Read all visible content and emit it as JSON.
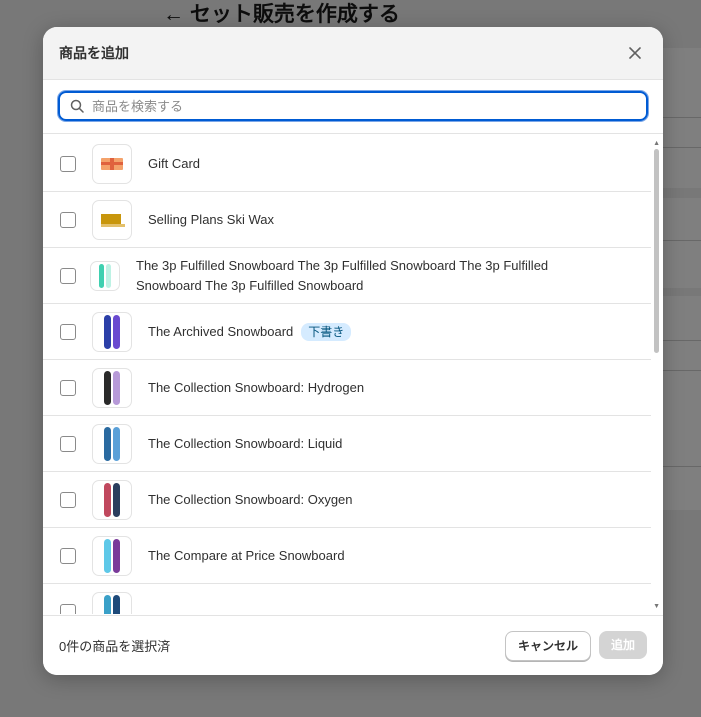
{
  "background": {
    "page_title": "← セット販売を作成する"
  },
  "modal": {
    "title": "商品を追加",
    "close_icon": "close-icon",
    "search": {
      "placeholder": "商品を検索する",
      "value": ""
    },
    "products": [
      {
        "name": "Gift Card",
        "thumb": "gift-card",
        "badge": ""
      },
      {
        "name": "Selling Plans Ski Wax",
        "thumb": "ski-wax",
        "badge": ""
      },
      {
        "name": "The 3p Fulfilled Snowboard The 3p Fulfilled Snowboard The 3p Fulfilled Snowboard The 3p Fulfilled Snowboard",
        "thumb": "snowboard-teal",
        "badge": ""
      },
      {
        "name": "The Archived Snowboard",
        "thumb": "snowboard-purple",
        "badge": "下書き"
      },
      {
        "name": "The Collection Snowboard: Hydrogen",
        "thumb": "snowboard-dark",
        "badge": ""
      },
      {
        "name": "The Collection Snowboard: Liquid",
        "thumb": "snowboard-blue",
        "badge": ""
      },
      {
        "name": "The Collection Snowboard: Oxygen",
        "thumb": "snowboard-red",
        "badge": ""
      },
      {
        "name": "The Compare at Price Snowboard",
        "thumb": "snowboard-cyan",
        "badge": ""
      }
    ],
    "footer": {
      "selected_text": "0件の商品を選択済",
      "cancel_label": "キャンセル",
      "add_label": "追加"
    }
  },
  "colors": {
    "focus_ring": "#005bd3",
    "badge_bg": "#d5ebff",
    "disabled_button": "#d4d4d4"
  }
}
